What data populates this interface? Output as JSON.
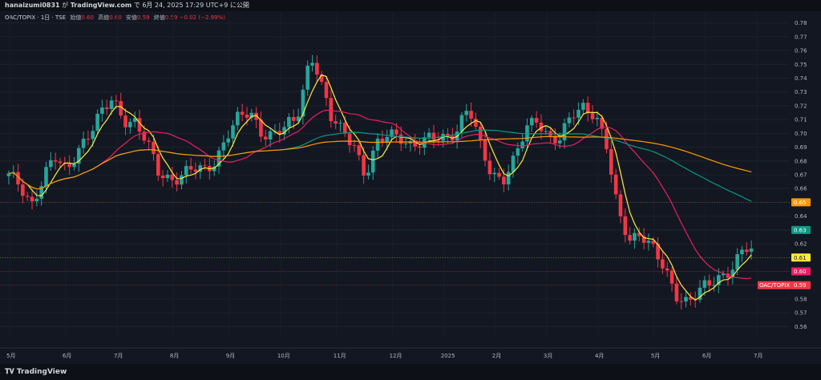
{
  "header": {
    "author": "hanaizumi0831",
    "caption_mid": " が ",
    "site": "TradingView.com",
    "caption_tail": " で 6月 24, 2025 17:29 UTC+9 に公開"
  },
  "legend": {
    "symbol": "OAC/TOPIX · 1日 · TSE",
    "open_label": "始値",
    "open_value": "0.60",
    "high_label": "高値",
    "high_value": "0.60",
    "low_label": "安値",
    "low_value": "0.59",
    "close_label": "終値",
    "close_value": "0.59",
    "change": "−0.02 (−2.99%)"
  },
  "footer": {
    "brand": "TradingView"
  },
  "colors": {
    "up": "#26a69a",
    "down": "#f23645",
    "ma_short": "#ffeb3b",
    "ma_mid": "#e91e63",
    "ma_long": "#089981",
    "ma_longest": "#ff9800",
    "background": "#131722"
  },
  "chart_data": {
    "type": "line",
    "title": "OAC/TOPIX · 1日 · TSE",
    "x_labels": [
      "5月",
      "6月",
      "7月",
      "8月",
      "9月",
      "10月",
      "11月",
      "12月",
      "2025",
      "2月",
      "3月",
      "4月",
      "5月",
      "6月",
      "7月"
    ],
    "y_ticks": [
      "0.56",
      "0.57",
      "0.58",
      "0.59",
      "0.60",
      "0.61",
      "0.62",
      "0.63",
      "0.64",
      "0.65",
      "0.66",
      "0.67",
      "0.68",
      "0.69",
      "0.70",
      "0.71",
      "0.72",
      "0.73",
      "0.74",
      "0.75",
      "0.76",
      "0.77",
      "0.78"
    ],
    "ylim": [
      0.555,
      0.785
    ],
    "price_anchors": [
      [
        0,
        0.668
      ],
      [
        2,
        0.662
      ],
      [
        4,
        0.65
      ],
      [
        6,
        0.668
      ],
      [
        8,
        0.681
      ],
      [
        10,
        0.672
      ],
      [
        12,
        0.69
      ],
      [
        14,
        0.7
      ],
      [
        16,
        0.712
      ],
      [
        18,
        0.725
      ],
      [
        20,
        0.712
      ],
      [
        22,
        0.708
      ],
      [
        24,
        0.692
      ],
      [
        26,
        0.672
      ],
      [
        28,
        0.668
      ],
      [
        30,
        0.67
      ],
      [
        32,
        0.673
      ],
      [
        34,
        0.672
      ],
      [
        36,
        0.682
      ],
      [
        38,
        0.7
      ],
      [
        40,
        0.71
      ],
      [
        42,
        0.714
      ],
      [
        44,
        0.702
      ],
      [
        46,
        0.7
      ],
      [
        48,
        0.703
      ],
      [
        50,
        0.708
      ],
      [
        52,
        0.748
      ],
      [
        53,
        0.758
      ],
      [
        54,
        0.742
      ],
      [
        56,
        0.71
      ],
      [
        58,
        0.7
      ],
      [
        60,
        0.695
      ],
      [
        62,
        0.67
      ],
      [
        64,
        0.69
      ],
      [
        66,
        0.698
      ],
      [
        68,
        0.7
      ],
      [
        70,
        0.692
      ],
      [
        72,
        0.692
      ],
      [
        74,
        0.696
      ],
      [
        76,
        0.698
      ],
      [
        78,
        0.704
      ],
      [
        80,
        0.718
      ],
      [
        82,
        0.69
      ],
      [
        84,
        0.672
      ],
      [
        86,
        0.668
      ],
      [
        88,
        0.68
      ],
      [
        90,
        0.702
      ],
      [
        92,
        0.712
      ],
      [
        94,
        0.698
      ],
      [
        96,
        0.695
      ],
      [
        98,
        0.712
      ],
      [
        100,
        0.72
      ],
      [
        102,
        0.716
      ],
      [
        104,
        0.69
      ],
      [
        106,
        0.64
      ],
      [
        108,
        0.624
      ],
      [
        110,
        0.63
      ],
      [
        112,
        0.616
      ],
      [
        114,
        0.6
      ],
      [
        116,
        0.584
      ],
      [
        118,
        0.58
      ],
      [
        120,
        0.585
      ],
      [
        122,
        0.589
      ],
      [
        124,
        0.596
      ],
      [
        126,
        0.606
      ],
      [
        128,
        0.618
      ],
      [
        130,
        0.61
      ]
    ],
    "last_prices": [
      {
        "value": 0.65,
        "label": "0.65",
        "color": "#ff9800"
      },
      {
        "value": 0.63,
        "label": "0.63",
        "color": "#089981"
      },
      {
        "value": 0.61,
        "label": "0.61",
        "color": "#ffeb3b"
      },
      {
        "value": 0.6,
        "label": "0.60",
        "color": "#e91e63"
      },
      {
        "value": 0.59,
        "label": "0.59",
        "color": "#f23645",
        "tag": "OAC/TOPIX"
      }
    ],
    "moving_averages": [
      5,
      20,
      60,
      100
    ],
    "grid": true
  }
}
